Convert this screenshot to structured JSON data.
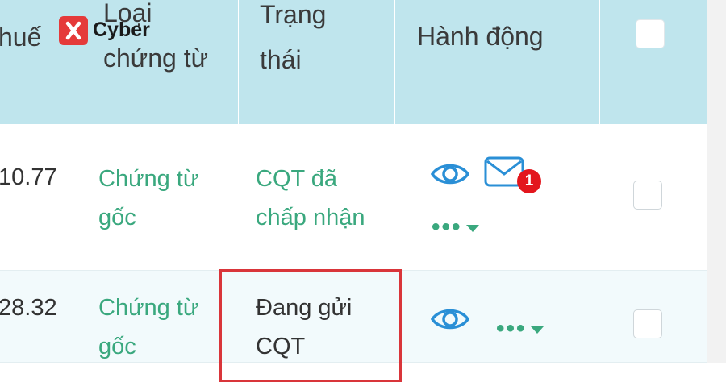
{
  "header": {
    "col_tax": "huế",
    "col_doc_type_line1": "Loại",
    "col_doc_type_line2": "chứng từ",
    "col_status_line1": "Trạng",
    "col_status_line2": "thái",
    "col_actions": "Hành động"
  },
  "logo": {
    "text": "Cyber"
  },
  "rows": [
    {
      "amount": "10.77",
      "doc_type_line1": "Chứng từ",
      "doc_type_line2": "gốc",
      "status_line1": "CQT đã",
      "status_line2": "chấp nhận",
      "mail_badge": "1",
      "more": "•••"
    },
    {
      "amount": "28.32",
      "doc_type_line1": "Chứng từ",
      "doc_type_line2": "gốc",
      "status_line1": "Đang gửi",
      "status_line2": "CQT",
      "more": "•••"
    }
  ],
  "colors": {
    "header_bg": "#bfe5ed",
    "accent_green": "#3aa87e",
    "icon_blue": "#2a8fd6",
    "badge_red": "#e3161d",
    "highlight_red": "#d9353a"
  }
}
